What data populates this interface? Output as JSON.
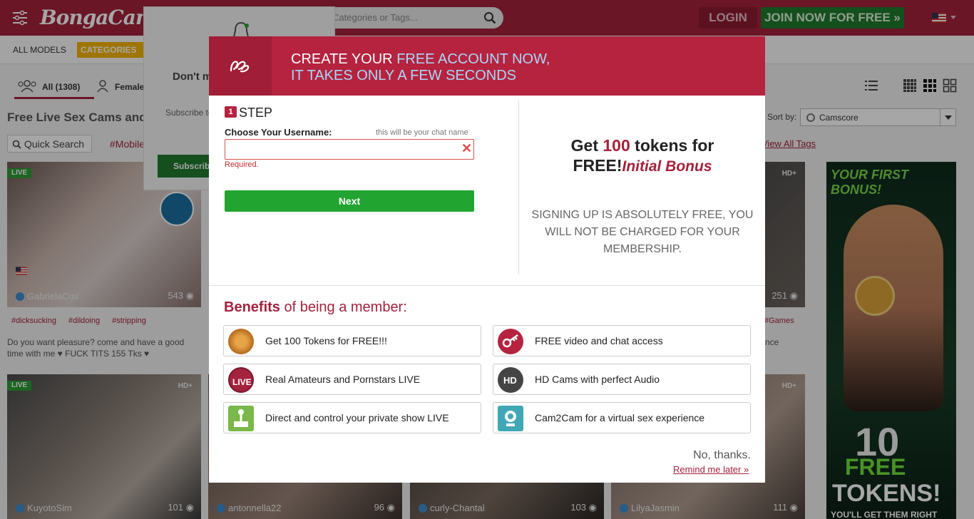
{
  "header": {
    "logo_text": "BongaCams",
    "search_placeholder": "Categories or Tags...",
    "login_label": "LOGIN",
    "join_label": "JOIN NOW FOR FREE »",
    "flag": "us-flag-icon"
  },
  "nav": {
    "all_models": "ALL MODELS",
    "categories": "CATEGORIES"
  },
  "tabs": {
    "all_label": "All (1308)",
    "female_label": "Female"
  },
  "listing": {
    "title": "Free Live Sex Cams and",
    "quick_search": "Quick Search",
    "tag_mobile": "#Mobile",
    "sort_label": "Sort by:",
    "sort_value": "Camscore",
    "view_all_tags": "View All Tags"
  },
  "tiles": [
    {
      "name": "GabrielaCox",
      "viewers": "543",
      "live": "LIVE",
      "hd": "",
      "tags": [
        "#dicksucking",
        "#dildoing",
        "#stripping"
      ],
      "desc": "Do you want pleasure? come and have a good time with me ♥ FUCK TITS 155 Tks ♥"
    },
    {
      "name": "KuyotoSim",
      "viewers": "101",
      "live": "LIVE",
      "hd": "HD+"
    },
    {
      "name": "antonnella22",
      "viewers": "96"
    },
    {
      "name": "curly-Chantal",
      "viewers": "103"
    },
    {
      "name": "LilyaJasmin",
      "viewers": "111",
      "hd": "HD+"
    },
    {
      "name": "",
      "viewers": "251",
      "hd": "HD+",
      "tags": [
        "#Games"
      ],
      "desc": "nce"
    }
  ],
  "banner": {
    "top": "YOUR FIRST BONUS!",
    "ten": "10",
    "free": "FREE",
    "tokens": "TOKENS!",
    "bottom": "YOU'LL GET THEM RIGHT"
  },
  "subscribe_popup": {
    "title": "Don't miss important",
    "text": "Subscribe to among the f biggest di",
    "button": "Subscrib"
  },
  "modal": {
    "header_line1_a": "CREATE YOUR ",
    "header_line1_b": "FREE ACCOUNT NOW,",
    "header_line2": "IT TAKES ONLY A FEW SECONDS",
    "step_number": "1",
    "step_label": "STEP",
    "username_label": "Choose Your Username:",
    "username_hint": "this will be your chat name",
    "username_value": "",
    "required": "Required.",
    "next": "Next",
    "get": "Get ",
    "tokens_count": "100",
    "tokens_for": " tokens for",
    "free": "FREE!",
    "initial_bonus": "Initial Bonus",
    "free_text": "SIGNING UP IS ABSOLUTELY FREE, YOU WILL NOT BE CHARGED FOR YOUR MEMBERSHIP.",
    "benefits_bold": "Benefits",
    "benefits_rest": " of being a member:",
    "benefits": [
      {
        "text": "Get 100 Tokens for FREE!!!",
        "icon": "token-coin-icon"
      },
      {
        "text": "FREE video and chat access",
        "icon": "key-icon"
      },
      {
        "text": "Real Amateurs and Pornstars LIVE",
        "icon": "live-badge-icon"
      },
      {
        "text": "HD Cams with perfect Audio",
        "icon": "hd-badge-icon"
      },
      {
        "text": "Direct and control your private show LIVE",
        "icon": "joystick-icon"
      },
      {
        "text": "Cam2Cam for a virtual sex experience",
        "icon": "webcam-icon"
      }
    ],
    "no_thanks": "No, thanks.",
    "remind": "Remind me later »"
  },
  "colors": {
    "brand": "#a3223c",
    "join_green": "#1f7a2e",
    "next_green": "#22a530",
    "header_highlight": "#a9d8f8"
  }
}
